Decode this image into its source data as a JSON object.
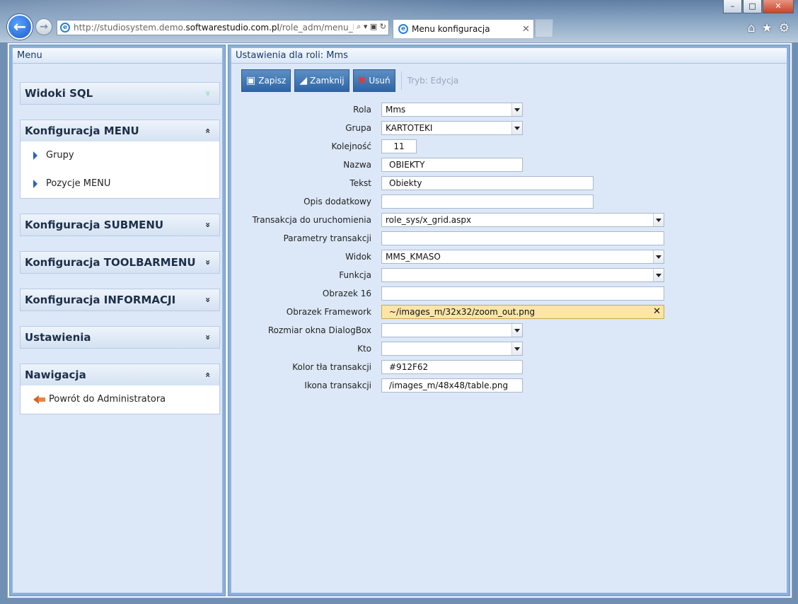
{
  "browser": {
    "url_prefix": "http://studiosystem.demo.",
    "url_domain": "softwarestudio.com.pl",
    "url_suffix": "/role_adm/menu_kon",
    "tab_title": "Menu konfiguracja",
    "address_tools": "⌕ ▾ ▣ ↻",
    "controls": {
      "minimize": "–",
      "maximize": "□",
      "close": "✕"
    },
    "nav": {
      "back": "←",
      "forward": "→",
      "tab_close": "✕"
    },
    "right_tools": {
      "home": "⌂",
      "favorites": "★",
      "settings": "⚙"
    }
  },
  "left_panel": {
    "title": "Menu",
    "sections": [
      {
        "title": "Widoki SQL",
        "chevron": "»",
        "items": []
      },
      {
        "title": "Konfiguracja MENU",
        "chevron": "«",
        "items": [
          "Grupy",
          "Pozycje MENU"
        ]
      },
      {
        "title": "Konfiguracja SUBMENU",
        "chevron": "»",
        "items": []
      },
      {
        "title": "Konfiguracja TOOLBARMENU",
        "chevron": "»",
        "items": []
      },
      {
        "title": "Konfiguracja INFORMACJI",
        "chevron": "»",
        "items": []
      },
      {
        "title": "Ustawienia",
        "chevron": "»",
        "items": []
      },
      {
        "title": "Nawigacja",
        "chevron": "«",
        "items": [
          "Powrót do Administratora"
        ]
      }
    ]
  },
  "right_panel": {
    "title": "Ustawienia dla roli: Mms",
    "toolbar": {
      "save_label": "Zapisz",
      "close_label": "Zamknij",
      "delete_label": "Usuń",
      "mode_label": "Tryb: Edycja",
      "save_icon": "▣",
      "close_icon": "◢",
      "delete_icon": "✖"
    },
    "fields": [
      {
        "label": "Rola",
        "value": "Mms"
      },
      {
        "label": "Grupa",
        "value": "KARTOTEKI"
      },
      {
        "label": "Kolejność",
        "value": "11"
      },
      {
        "label": "Nazwa",
        "value": "OBIEKTY"
      },
      {
        "label": "Tekst",
        "value": "Obiekty"
      },
      {
        "label": "Opis dodatkowy",
        "value": ""
      },
      {
        "label": "Transakcja do uruchomienia",
        "value": "role_sys/x_grid.aspx"
      },
      {
        "label": "Parametry transakcji",
        "value": ""
      },
      {
        "label": "Widok",
        "value": "MMS_KMASO"
      },
      {
        "label": "Funkcja",
        "value": ""
      },
      {
        "label": "Obrazek 16",
        "value": ""
      },
      {
        "label": "Obrazek Framework",
        "value": "~/images_m/32x32/zoom_out.png",
        "clear_icon": "✕"
      },
      {
        "label": "Rozmiar okna DialogBox",
        "value": ""
      },
      {
        "label": "Kto",
        "value": ""
      },
      {
        "label": "Kolor tła transakcji",
        "value": "#912F62"
      },
      {
        "label": "Ikona transakcji",
        "value": "/images_m/48x48/table.png"
      }
    ]
  }
}
